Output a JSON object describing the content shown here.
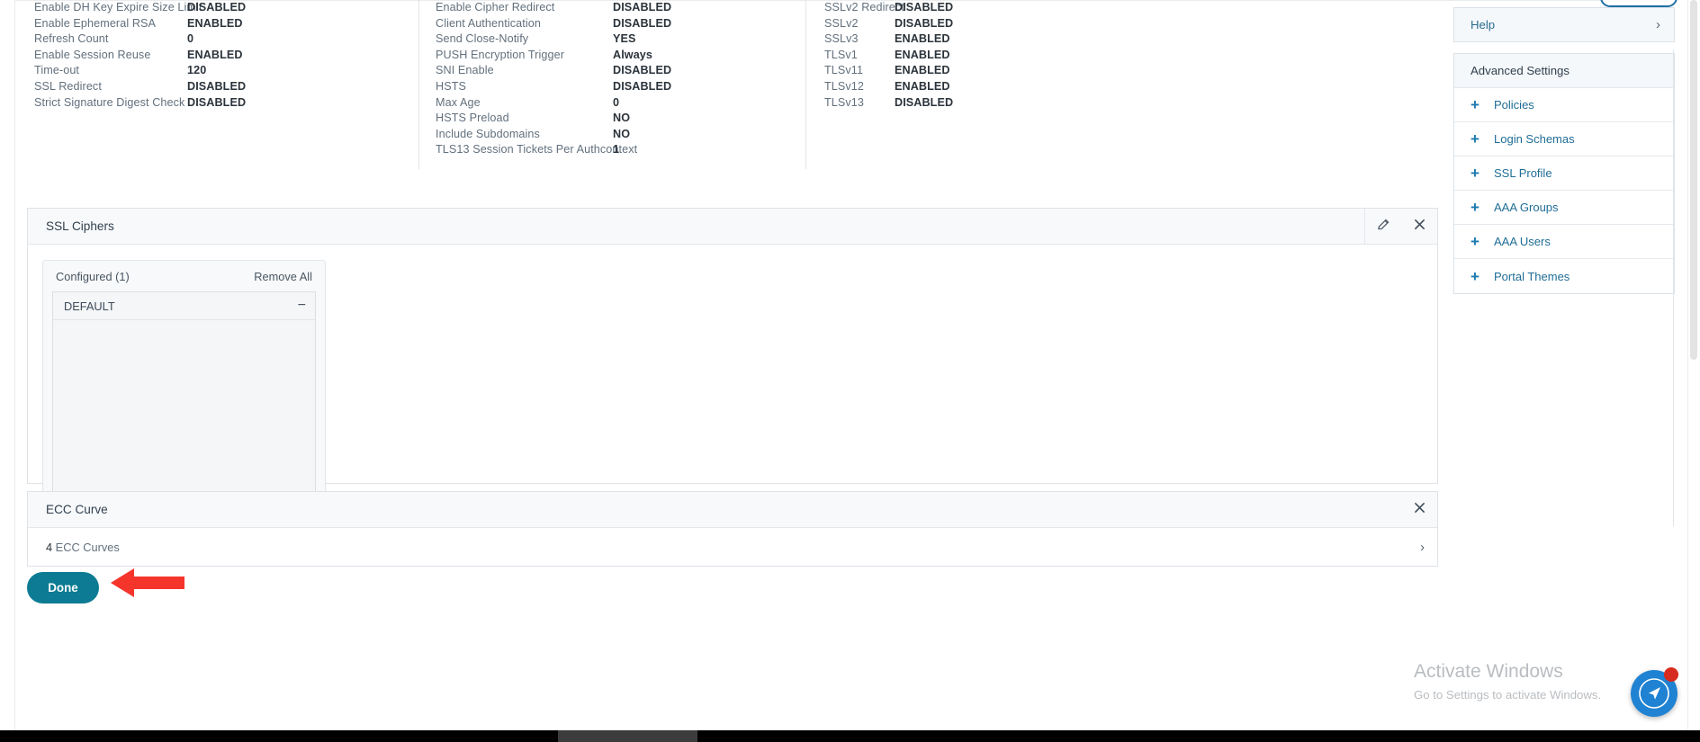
{
  "summary": {
    "columns": [
      {
        "id": "col-ssl-basic",
        "rows": [
          {
            "key": "Enable DH Key Expire Size Limit",
            "value": "DISABLED"
          },
          {
            "key": "Enable Ephemeral RSA",
            "value": "ENABLED"
          },
          {
            "key": "Refresh Count",
            "value": "0"
          },
          {
            "key": "Enable Session Reuse",
            "value": "ENABLED"
          },
          {
            "key": "Time-out",
            "value": "120"
          },
          {
            "key": "SSL Redirect",
            "value": "DISABLED"
          },
          {
            "key": "Strict Signature Digest Check",
            "value": "DISABLED"
          }
        ]
      },
      {
        "id": "col-ssl-cipher-hsts",
        "rows": [
          {
            "key": "Enable Cipher Redirect",
            "value": "DISABLED"
          },
          {
            "key": "Client Authentication",
            "value": "DISABLED"
          },
          {
            "key": "Send Close-Notify",
            "value": "YES"
          },
          {
            "key": "PUSH Encryption Trigger",
            "value": "Always"
          },
          {
            "key": "SNI Enable",
            "value": "DISABLED"
          },
          {
            "key": "HSTS",
            "value": "DISABLED"
          },
          {
            "key": "Max Age",
            "value": "0"
          },
          {
            "key": "HSTS Preload",
            "value": "NO"
          },
          {
            "key": "Include Subdomains",
            "value": "NO"
          },
          {
            "key": "TLS13 Session Tickets Per Authcontext",
            "value": "1"
          }
        ]
      },
      {
        "id": "col-protocols",
        "rows": [
          {
            "key": "SSLv2 Redirect",
            "value": "DISABLED"
          },
          {
            "key": "SSLv2",
            "value": "DISABLED"
          },
          {
            "key": "SSLv3",
            "value": "ENABLED"
          },
          {
            "key": "TLSv1",
            "value": "ENABLED"
          },
          {
            "key": "TLSv11",
            "value": "ENABLED"
          },
          {
            "key": "TLSv12",
            "value": "ENABLED"
          },
          {
            "key": "TLSv13",
            "value": "DISABLED"
          }
        ]
      }
    ]
  },
  "ssl_ciphers": {
    "title": "SSL Ciphers",
    "configured_label": "Configured (1)",
    "remove_all_label": "Remove All",
    "items": [
      {
        "name": "DEFAULT"
      }
    ]
  },
  "ecc_curve": {
    "title": "ECC Curve",
    "count": "4",
    "count_suffix": " ECC Curves"
  },
  "done_button": {
    "label": "Done"
  },
  "sidebar": {
    "help_label": "Help",
    "advanced_title": "Advanced Settings",
    "advanced_items": [
      {
        "label": "Policies"
      },
      {
        "label": "Login Schemas"
      },
      {
        "label": "SSL Profile"
      },
      {
        "label": "AAA Groups"
      },
      {
        "label": "AAA Users"
      },
      {
        "label": "Portal Themes"
      }
    ]
  },
  "watermark": {
    "title": "Activate Windows",
    "subtitle": "Go to Settings to activate Windows."
  },
  "colors": {
    "accent_teal": "#0c7b93",
    "link_blue": "#1f6d96",
    "fab_blue": "#1f82d2",
    "badge_red": "#d62b1e",
    "arrow_red": "#f5342b"
  }
}
